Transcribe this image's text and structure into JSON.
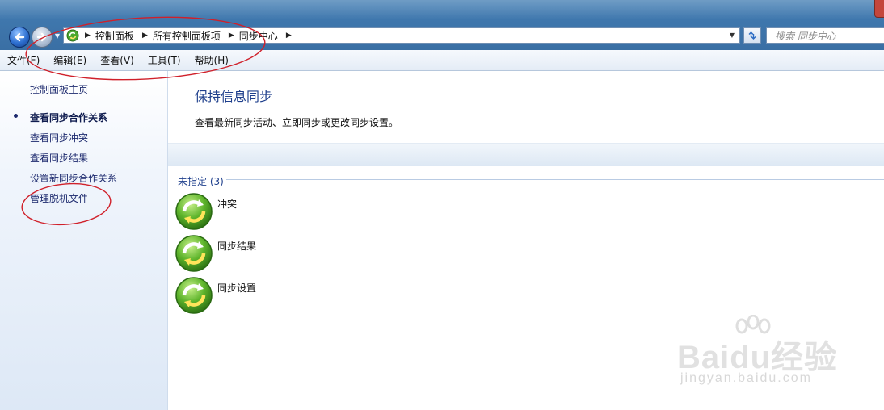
{
  "address_bar": {
    "breadcrumbs": [
      "控制面板",
      "所有控制面板项",
      "同步中心"
    ],
    "search_placeholder": "搜索 同步中心"
  },
  "menu": [
    "文件(F)",
    "编辑(E)",
    "查看(V)",
    "工具(T)",
    "帮助(H)"
  ],
  "left_nav": {
    "home": "控制面板主页",
    "items": [
      "查看同步合作关系",
      "查看同步冲突",
      "查看同步结果",
      "设置新同步合作关系",
      "管理脱机文件"
    ],
    "active_index": 0
  },
  "main": {
    "title": "保持信息同步",
    "description": "查看最新同步活动、立即同步或更改同步设置。",
    "group_header": "未指定 (3)",
    "items": [
      "冲突",
      "同步结果",
      "同步设置"
    ]
  },
  "watermark": {
    "brand": "Baidu经验",
    "url": "jingyan.baidu.com"
  },
  "colors": {
    "link": "#1d2a6e",
    "title": "#1e3f8c",
    "annotation": "#d0202a"
  }
}
